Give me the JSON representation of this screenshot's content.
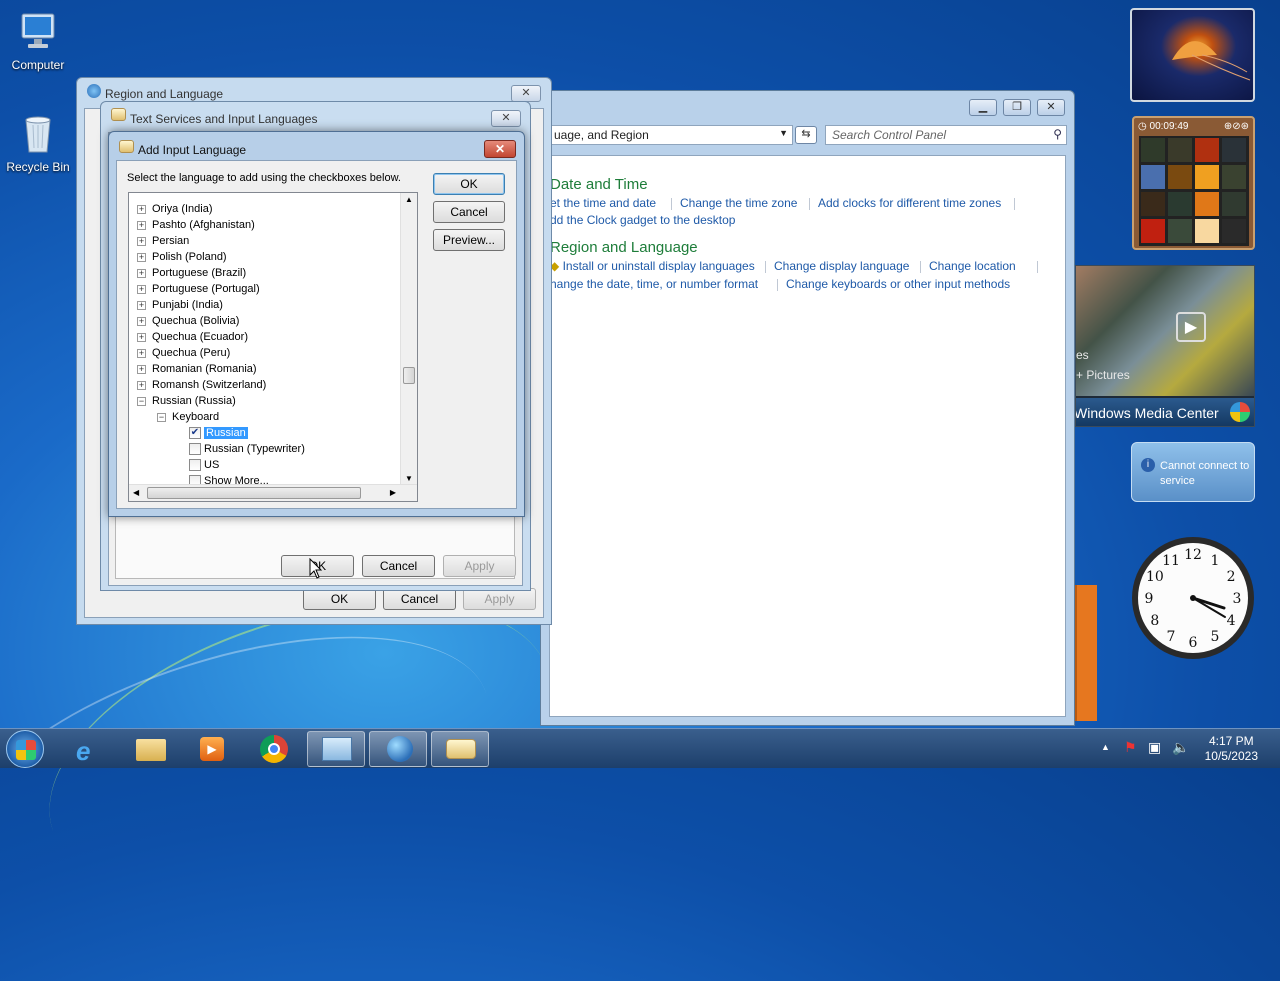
{
  "desktop": {
    "icons": [
      {
        "label": "Computer"
      },
      {
        "label": "Recycle Bin"
      }
    ]
  },
  "control_panel": {
    "address": "uage, and Region",
    "search_placeholder": "Search Control Panel",
    "sections": [
      {
        "title": "Date and Time",
        "links": [
          "et the time and date",
          "Change the time zone",
          "Add clocks for different time zones",
          "dd the Clock gadget to the desktop"
        ]
      },
      {
        "title": "Region and Language",
        "links": [
          "Install or uninstall display languages",
          "Change display language",
          "Change location",
          "hange the date, time, or number format",
          "Change keyboards or other input methods"
        ]
      }
    ]
  },
  "region_language": {
    "title": "Region and Language",
    "ok": "OK",
    "cancel": "Cancel",
    "apply": "Apply"
  },
  "text_services": {
    "title": "Text Services and Input Languages",
    "ok": "OK",
    "cancel": "Cancel",
    "apply": "Apply"
  },
  "add_input_language": {
    "title": "Add Input Language",
    "instruction": "Select the language to add using the checkboxes below.",
    "ok": "OK",
    "cancel": "Cancel",
    "preview": "Preview...",
    "tree": {
      "languages": [
        "Oriya (India)",
        "Pashto (Afghanistan)",
        "Persian",
        "Polish (Poland)",
        "Portuguese (Brazil)",
        "Portuguese (Portugal)",
        "Punjabi (India)",
        "Quechua (Bolivia)",
        "Quechua (Ecuador)",
        "Quechua (Peru)",
        "Romanian (Romania)",
        "Romansh (Switzerland)",
        "Russian (Russia)"
      ],
      "keyboard_label": "Keyboard",
      "keyboards": [
        {
          "label": "Russian",
          "checked": true,
          "selected": true
        },
        {
          "label": "Russian (Typewriter)",
          "checked": false,
          "selected": false
        },
        {
          "label": "US",
          "checked": false,
          "selected": false
        },
        {
          "label": "Show More...",
          "checked": false,
          "selected": false
        }
      ]
    }
  },
  "gadgets": {
    "puzzle_timer": "00:09:49",
    "media_center_label": "Windows Media Center",
    "media_pictures": "+ Pictures",
    "media_partial": "es",
    "weather_message": "Cannot connect to service",
    "clock_numbers": [
      "12",
      "1",
      "2",
      "3",
      "4",
      "5",
      "6",
      "7",
      "8",
      "9",
      "10",
      "11"
    ]
  },
  "taskbar": {
    "time": "4:17 PM",
    "date": "10/5/2023",
    "buttons": [
      "start",
      "internet-explorer",
      "windows-explorer",
      "media-player",
      "chrome",
      "control-panel",
      "region-language",
      "text-services"
    ]
  }
}
